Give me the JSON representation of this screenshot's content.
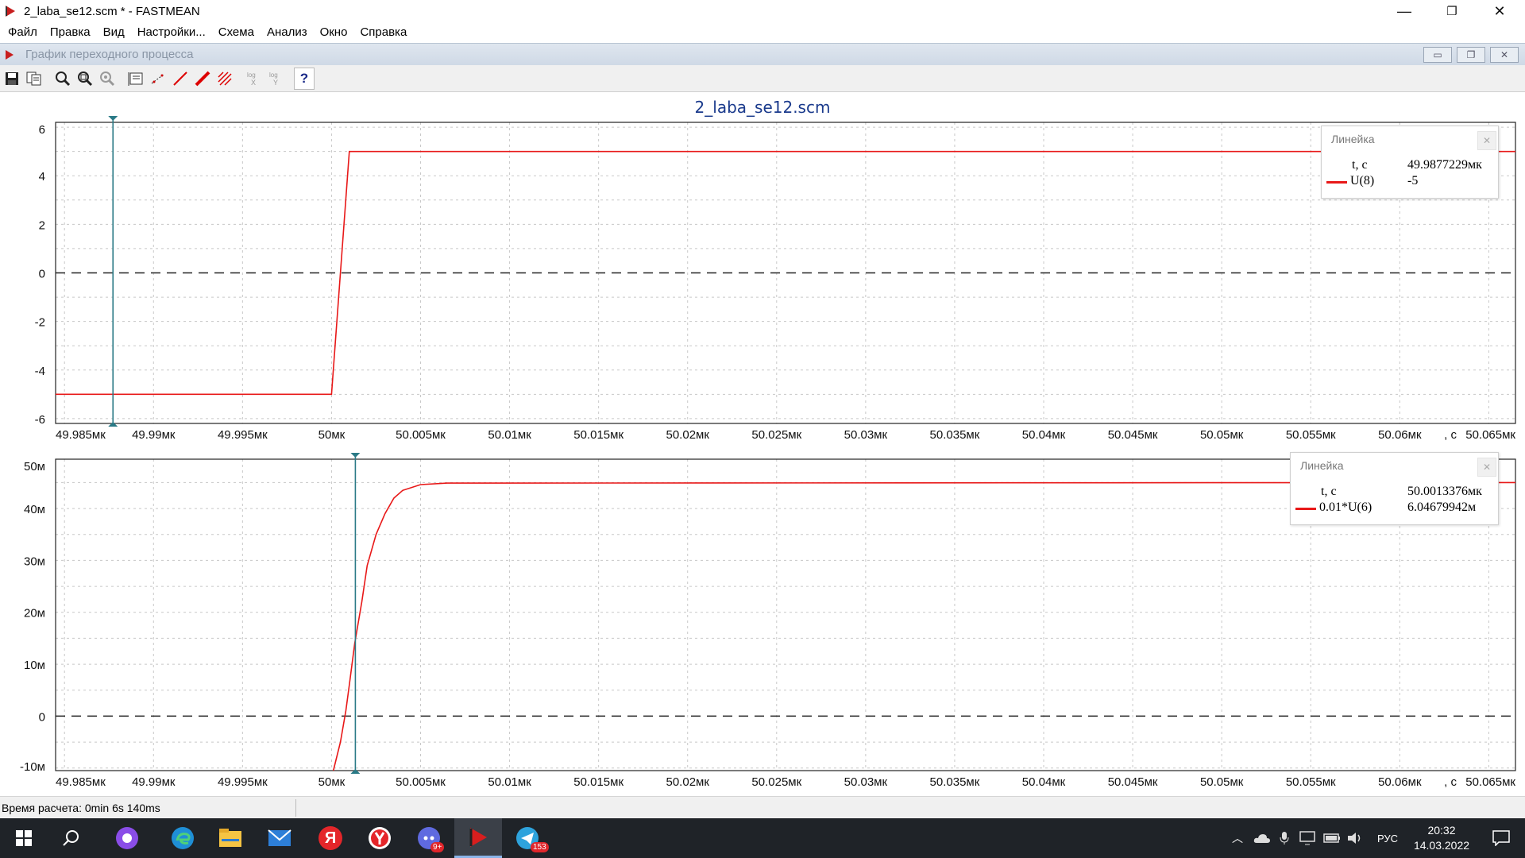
{
  "window": {
    "title": "2_laba_se12.scm * - FASTMEAN",
    "controls": {
      "minimize": "—",
      "restore": "❐",
      "close": "✕"
    }
  },
  "menu": [
    "Файл",
    "Правка",
    "Вид",
    "Настройки...",
    "Схема",
    "Анализ",
    "Окно",
    "Справка"
  ],
  "child_window": {
    "title": "График переходного процесса"
  },
  "toolbar": {
    "buttons": [
      {
        "icon": "save-icon"
      },
      {
        "icon": "copy-icon"
      },
      {
        "icon": "zoom-icon"
      },
      {
        "icon": "zoom-fit-icon"
      },
      {
        "icon": "zoom-reset-icon"
      },
      {
        "icon": "legend-icon"
      },
      {
        "icon": "points-icon"
      },
      {
        "icon": "line-icon"
      },
      {
        "icon": "bold-line-icon"
      },
      {
        "icon": "grid-icon"
      },
      {
        "icon": "log-x-icon",
        "label": "log"
      },
      {
        "icon": "log-y-icon",
        "label": "log"
      },
      {
        "icon": "help-icon",
        "label": "?"
      }
    ]
  },
  "plot_title": "2_laba_se12.scm",
  "rulers": [
    {
      "title": "Линейка",
      "x_name": "t, c",
      "x_value": "49.9877229мк",
      "series_name": "U(8)",
      "series_value": "-5"
    },
    {
      "title": "Линейка",
      "x_name": "t, c",
      "x_value": "50.0013376мк",
      "series_name": "0.01*U(6)",
      "series_value": "6.04679942м"
    }
  ],
  "x_axis_unit": "t, c",
  "chart_data": [
    {
      "type": "line",
      "title": "2_laba_se12.scm",
      "xlabel": "t, c",
      "ylabel": "",
      "x_tick_labels": [
        "49.985мк",
        "49.99мк",
        "49.995мк",
        "50мк",
        "50.005мк",
        "50.01мк",
        "50.015мк",
        "50.02мк",
        "50.025мк",
        "50.03мк",
        "50.035мк",
        "50.04мк",
        "50.045мк",
        "50.05мк",
        "50.055мк",
        "50.06мк",
        "50.065мк"
      ],
      "xlim": [
        49.9845,
        50.0665
      ],
      "ylim": [
        -6.2,
        6.2
      ],
      "y_ticks": [
        6,
        4,
        2,
        0,
        -2,
        -4,
        -6
      ],
      "y_tick_labels": [
        "6",
        "4",
        "2",
        "0",
        "-2",
        "-4",
        "-6"
      ],
      "grid": true,
      "series": [
        {
          "name": "U(8)",
          "color": "#e81818",
          "x": [
            49.9845,
            50.0,
            50.001,
            50.0665
          ],
          "y": [
            -5.0,
            -5.0,
            5.0,
            5.0
          ]
        }
      ],
      "cursor_x": 49.9877229,
      "zero_line": true
    },
    {
      "type": "line",
      "xlabel": "t, c",
      "ylabel": "",
      "x_tick_labels": [
        "49.985мк",
        "49.99мк",
        "49.995мк",
        "50мк",
        "50.005мк",
        "50.01мк",
        "50.015мк",
        "50.02мк",
        "50.025мк",
        "50.03мк",
        "50.035мк",
        "50.04мк",
        "50.045мк",
        "50.05мк",
        "50.055мк",
        "50.06мк",
        "50.065мк"
      ],
      "xlim": [
        49.9845,
        50.0665
      ],
      "ylim": [
        -10.5,
        49.5
      ],
      "y_ticks": [
        50,
        40,
        30,
        20,
        10,
        0,
        -10
      ],
      "y_tick_labels": [
        "50м",
        "40м",
        "30м",
        "20м",
        "10м",
        "0",
        "-10м"
      ],
      "grid": true,
      "series": [
        {
          "name": "0.01*U(6)",
          "color": "#e81818",
          "x": [
            50.0001,
            50.0005,
            50.0008,
            50.001,
            50.0013,
            50.0017,
            50.002,
            50.0025,
            50.003,
            50.0035,
            50.004,
            50.005,
            50.0065,
            50.0665
          ],
          "y": [
            -11,
            -5,
            1,
            6,
            14,
            22,
            29,
            35,
            39,
            42,
            43.5,
            44.6,
            44.9,
            45
          ]
        }
      ],
      "cursor_x": 50.0013376,
      "zero_line": true
    }
  ],
  "status": {
    "text": "Время расчета: 0min 6s 140ms"
  },
  "taskbar": {
    "apps": [
      {
        "icon": "start-icon"
      },
      {
        "icon": "search-icon"
      },
      {
        "icon": "alice-icon"
      },
      {
        "icon": "edge-icon"
      },
      {
        "icon": "explorer-icon"
      },
      {
        "icon": "mail-icon"
      },
      {
        "icon": "yandex-icon",
        "label": "Я"
      },
      {
        "icon": "yandex-browser-icon"
      },
      {
        "icon": "discord-icon",
        "badge": "9+"
      },
      {
        "icon": "fastmean-icon"
      },
      {
        "icon": "telegram-icon",
        "badge": "153"
      }
    ],
    "language": "РУС",
    "time": "20:32",
    "date": "14.03.2022"
  }
}
